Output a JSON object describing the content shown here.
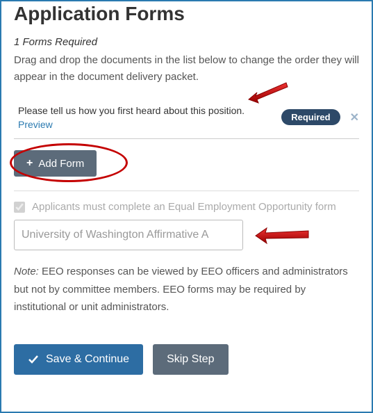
{
  "header": {
    "title": "Application Forms",
    "subheading": "1 Forms Required",
    "instructions": "Drag and drop the documents in the list below to change the order they will appear in the document delivery packet."
  },
  "form_item": {
    "question": "Please tell us how you first heard about this position.",
    "preview_label": "Preview",
    "badge": "Required"
  },
  "add_form": {
    "label": "Add Form"
  },
  "eeo": {
    "checkbox_label": "Applicants must complete an Equal Employment Opportunity form",
    "input_value": "University of Washington Affirmative A",
    "note_prefix": "Note:",
    "note_body": " EEO responses can be viewed by EEO officers and administrators but not by committee members. EEO forms may be required by institutional or unit administrators."
  },
  "actions": {
    "save": "Save & Continue",
    "skip": "Skip Step"
  }
}
